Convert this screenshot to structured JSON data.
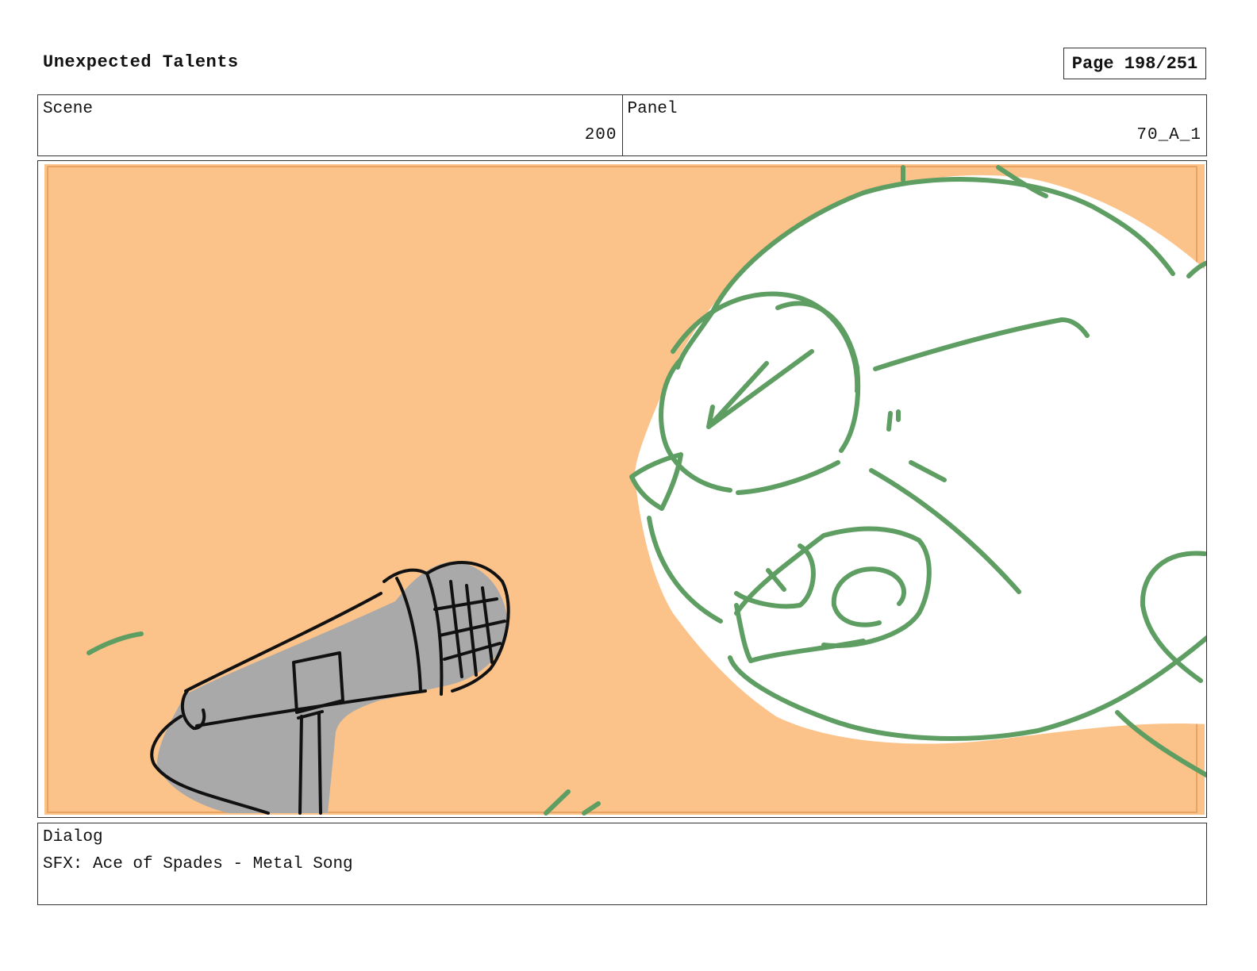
{
  "header": {
    "title": "Unexpected Talents",
    "page_label": "Page 198/251"
  },
  "info": {
    "scene_label": "Scene",
    "scene_value": "200",
    "panel_label": "Panel",
    "panel_value": "70_A_1"
  },
  "artwork": {
    "background_color": "#fbc38a",
    "character_line_color": "#5e9e62",
    "microphone_fill_color": "#a9a9a9",
    "ink_color": "#111111"
  },
  "dialog": {
    "label": "Dialog",
    "text": "SFX: Ace of Spades - Metal Song"
  }
}
